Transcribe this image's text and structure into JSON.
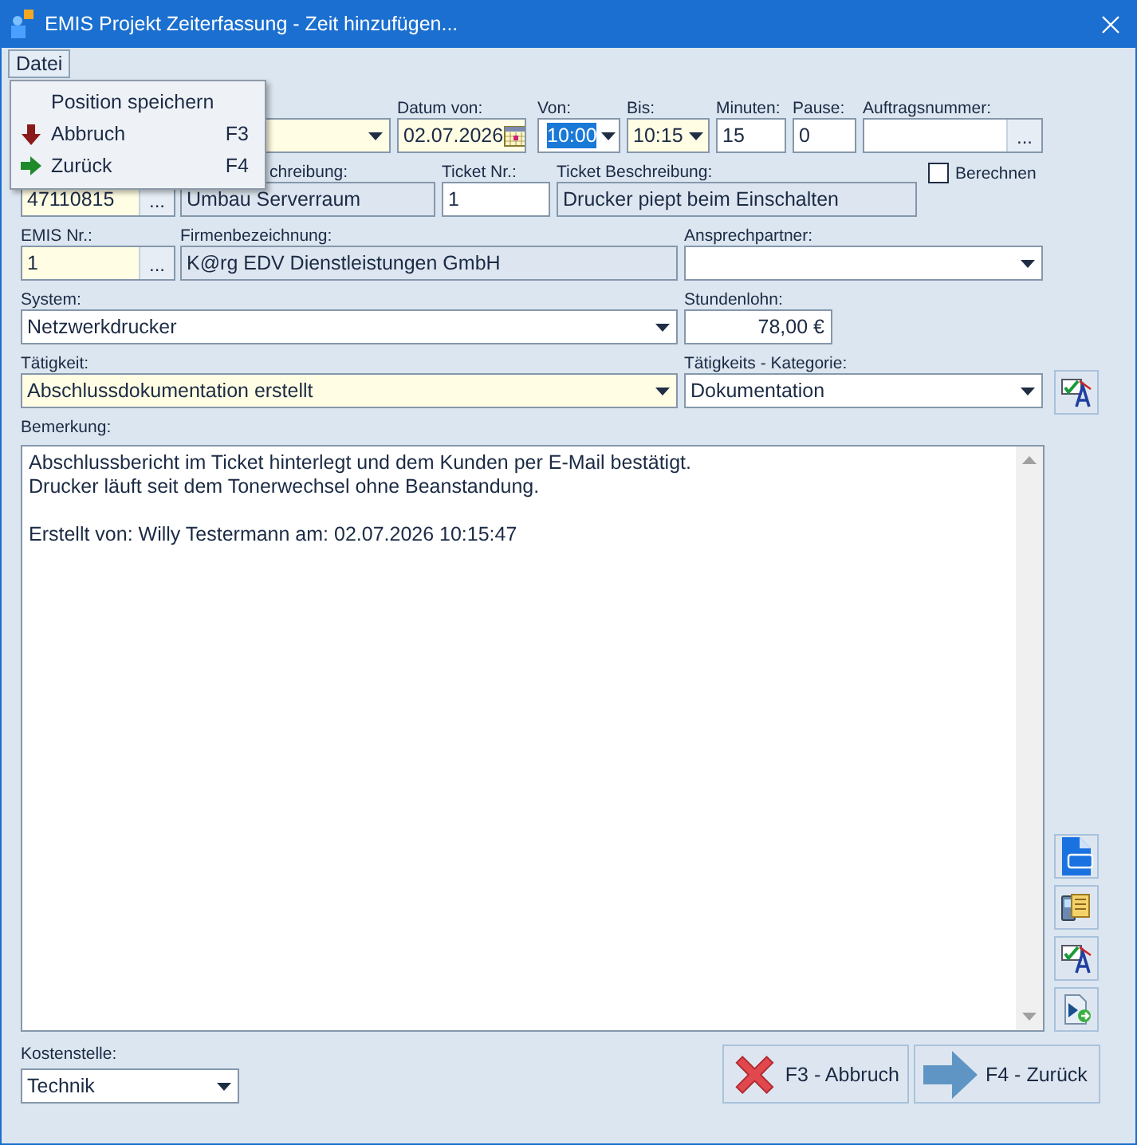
{
  "window": {
    "title": "EMIS Projekt Zeiterfassung - Zeit hinzufügen..."
  },
  "menu_bar": [
    {
      "label": "Datei",
      "selected": true
    }
  ],
  "menu": {
    "items": [
      {
        "label": "Position speichern",
        "kind": "plain"
      },
      {
        "label": "Abbruch",
        "shortcut": "F3",
        "kind": "cancel"
      },
      {
        "label": "Zurück",
        "shortcut": "F4",
        "kind": "back"
      }
    ]
  },
  "rows": [
    {
      "fields": [
        {
          "kind": "combo",
          "required": true
        },
        {
          "kind": "date",
          "label": "Datum von:",
          "value": "02.07.2026",
          "required": true
        },
        {
          "kind": "combo",
          "label": "Von:",
          "value": "10:00",
          "selected": true
        },
        {
          "kind": "combo",
          "label": "Bis:",
          "value": "10:15",
          "required": true
        },
        {
          "kind": "text",
          "label": "Minuten:",
          "value": "15"
        },
        {
          "kind": "text",
          "label": "Pause:",
          "value": "0"
        },
        {
          "kind": "lookup",
          "label": "Auftragsnummer:",
          "button": "..."
        }
      ]
    },
    {
      "fields": [
        {
          "kind": "lookup",
          "value": "47110815",
          "button": "...",
          "required": true
        },
        {
          "kind": "readonly",
          "label": "chreibung:",
          "value": "Umbau Serverraum"
        },
        {
          "kind": "text",
          "label": "Ticket Nr.:",
          "value": "1"
        },
        {
          "kind": "readonly",
          "label": "Ticket Beschreibung:",
          "value": "Drucker piept beim Einschalten"
        },
        {
          "kind": "checkbox",
          "label": "Berechnen",
          "checked": false
        }
      ]
    },
    {
      "fields": [
        {
          "kind": "lookup",
          "label": "EMIS Nr.:",
          "value": "1",
          "button": "...",
          "required": true
        },
        {
          "kind": "readonly",
          "label": "Firmenbezeichnung:",
          "value": "K@rg EDV Dienstleistungen GmbH"
        },
        {
          "kind": "combo",
          "label": "Ansprechpartner:"
        }
      ]
    },
    {
      "fields": [
        {
          "kind": "combo",
          "label": "System:",
          "value": "Netzwerkdrucker"
        },
        {
          "kind": "money",
          "label": "Stundenlohn:",
          "value": "78,00 €"
        }
      ]
    },
    {
      "fields": [
        {
          "kind": "combo",
          "label": "Tätigkeit:",
          "value": "Abschlussdokumentation erstellt",
          "required": true
        },
        {
          "kind": "combo",
          "label": "Tätigkeits - Kategorie:",
          "value": "Dokumentation"
        },
        {
          "kind": "spell"
        }
      ]
    }
  ],
  "remark": {
    "label": "Bemerkung:",
    "value": "Abschlussbericht im Ticket hinterlegt und dem Kunden per E-Mail bestätigt.\nDrucker läuft seit dem Tonerwechsel ohne Beanstandung.\n\nErstellt von: Willy Testermann am: 02.07.2026 10:15:47"
  },
  "side_tools": [
    {
      "kind": "ai"
    },
    {
      "kind": "copy"
    },
    {
      "kind": "spell"
    },
    {
      "kind": "run"
    }
  ],
  "cost_center": {
    "label": "Kostenstelle:",
    "value": "Technik"
  },
  "buttons": [
    {
      "label": "F3 - Abbruch",
      "kind": "cancel"
    },
    {
      "label": "F4 - Zurück",
      "kind": "back"
    }
  ]
}
